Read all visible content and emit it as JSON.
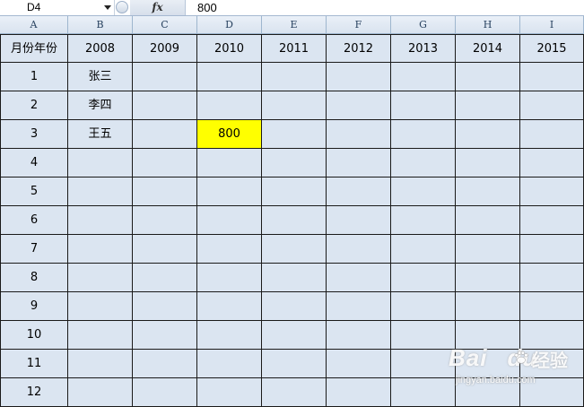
{
  "formula_bar": {
    "name_box": "D4",
    "fx_label": "fx",
    "formula_value": "800"
  },
  "columns": [
    "A",
    "B",
    "C",
    "D",
    "E",
    "F",
    "G",
    "H",
    "I"
  ],
  "header_row": [
    "月份年份",
    "2008",
    "2009",
    "2010",
    "2011",
    "2012",
    "2013",
    "2014",
    "2015"
  ],
  "rows": [
    [
      "1",
      "张三",
      "",
      "",
      "",
      "",
      "",
      "",
      ""
    ],
    [
      "2",
      "李四",
      "",
      "",
      "",
      "",
      "",
      "",
      ""
    ],
    [
      "3",
      "王五",
      "",
      "800",
      "",
      "",
      "",
      "",
      ""
    ],
    [
      "4",
      "",
      "",
      "",
      "",
      "",
      "",
      "",
      ""
    ],
    [
      "5",
      "",
      "",
      "",
      "",
      "",
      "",
      "",
      ""
    ],
    [
      "6",
      "",
      "",
      "",
      "",
      "",
      "",
      "",
      ""
    ],
    [
      "7",
      "",
      "",
      "",
      "",
      "",
      "",
      "",
      ""
    ],
    [
      "8",
      "",
      "",
      "",
      "",
      "",
      "",
      "",
      ""
    ],
    [
      "9",
      "",
      "",
      "",
      "",
      "",
      "",
      "",
      ""
    ],
    [
      "10",
      "",
      "",
      "",
      "",
      "",
      "",
      "",
      ""
    ],
    [
      "11",
      "",
      "",
      "",
      "",
      "",
      "",
      "",
      ""
    ],
    [
      "12",
      "",
      "",
      "",
      "",
      "",
      "",
      "",
      ""
    ]
  ],
  "highlight": {
    "row": 2,
    "col": 3,
    "color": "#ffff00"
  },
  "colors": {
    "cell_bg": "#dbe5f1",
    "grid_line": "#1a1a1a"
  },
  "watermark": {
    "logo": "Bai",
    "logo2": "du",
    "cn": "经验",
    "url": "jingyan.baidu.com"
  }
}
